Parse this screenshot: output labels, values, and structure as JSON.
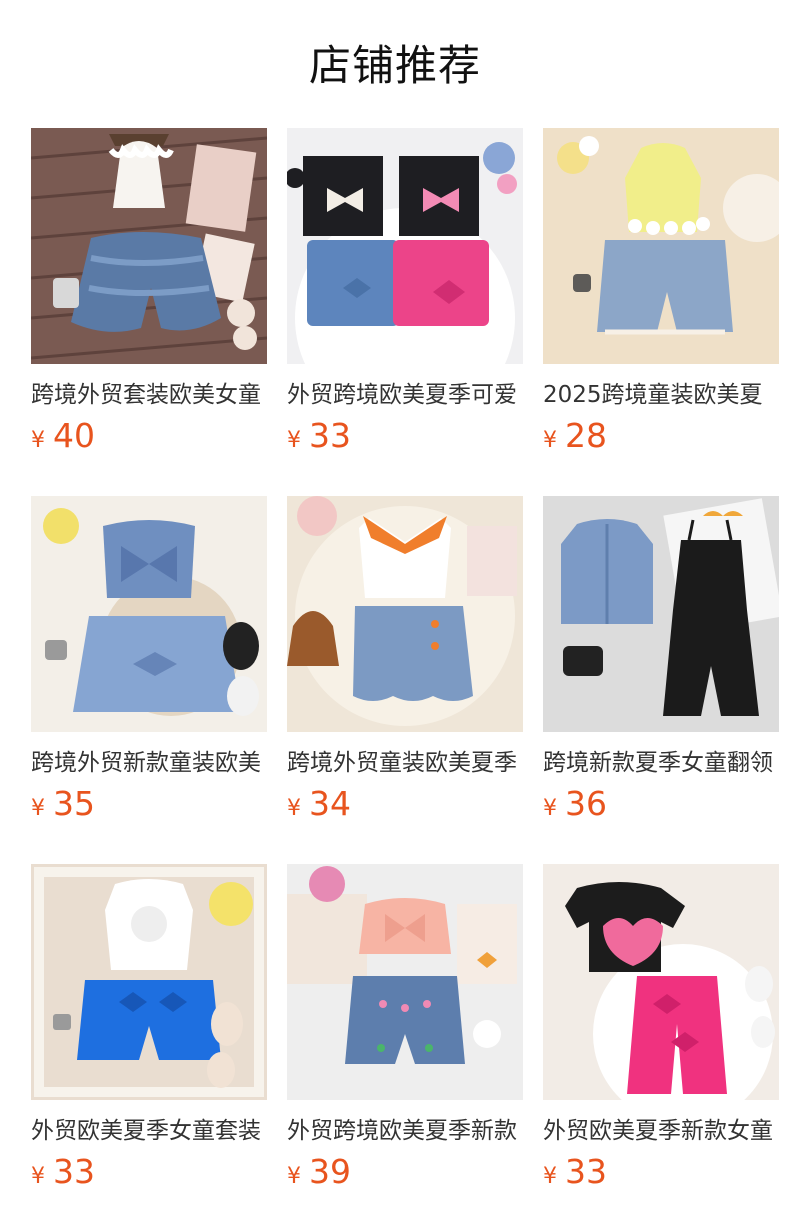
{
  "header": {
    "title": "店铺推荐"
  },
  "currency": "¥",
  "products": [
    {
      "name": "跨境外贸套装欧美女童",
      "price": "40"
    },
    {
      "name": "外贸跨境欧美夏季可爱",
      "price": "33"
    },
    {
      "name": "2025跨境童装欧美夏",
      "price": "28"
    },
    {
      "name": "跨境外贸新款童装欧美",
      "price": "35"
    },
    {
      "name": "跨境外贸童装欧美夏季",
      "price": "34"
    },
    {
      "name": "跨境新款夏季女童翻领",
      "price": "36"
    },
    {
      "name": "外贸欧美夏季女童套装",
      "price": "33"
    },
    {
      "name": "外贸跨境欧美夏季新款",
      "price": "39"
    },
    {
      "name": "外贸欧美夏季新款女童",
      "price": "33"
    }
  ],
  "colors": {
    "price": "#e8541e",
    "title": "#111111",
    "name": "#333333"
  }
}
